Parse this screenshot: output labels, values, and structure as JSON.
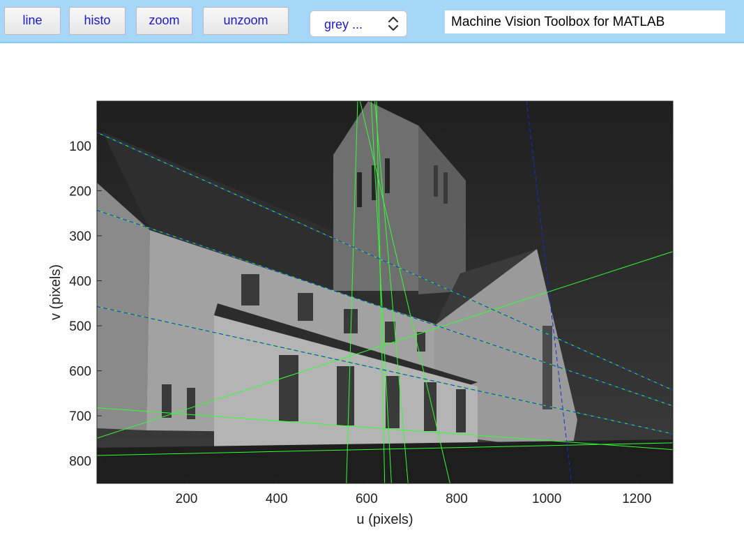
{
  "toolbar": {
    "line_label": "line",
    "histo_label": "histo",
    "zoom_label": "zoom",
    "unzoom_label": "unzoom",
    "colormap_value": "grey ...",
    "title": "Machine Vision Toolbox for MATLAB"
  },
  "axes": {
    "xlabel": "u (pixels)",
    "ylabel": "v (pixels)",
    "xlim": [
      1,
      1280
    ],
    "ylim": [
      1,
      850
    ],
    "y_reversed": true,
    "x_ticks": [
      200,
      400,
      600,
      800,
      1000,
      1200
    ],
    "y_ticks": [
      100,
      200,
      300,
      400,
      500,
      600,
      700,
      800
    ]
  },
  "overlay_lines": {
    "blue_dashed": [
      [
        [
          0,
          70
        ],
        [
          1280,
          643
        ]
      ],
      [
        [
          0,
          243
        ],
        [
          1280,
          678
        ]
      ],
      [
        [
          0,
          457
        ],
        [
          1280,
          740
        ]
      ],
      [
        [
          955,
          0
        ],
        [
          1055,
          850
        ]
      ]
    ],
    "green_solid": [
      [
        [
          0,
          70
        ],
        [
          1280,
          643
        ]
      ],
      [
        [
          0,
          243
        ],
        [
          1280,
          678
        ]
      ],
      [
        [
          0,
          457
        ],
        [
          1280,
          740
        ]
      ],
      [
        [
          580,
          0
        ],
        [
          555,
          850
        ]
      ],
      [
        [
          618,
          0
        ],
        [
          692,
          850
        ]
      ],
      [
        [
          610,
          0
        ],
        [
          655,
          850
        ]
      ],
      [
        [
          622,
          0
        ],
        [
          640,
          850
        ]
      ],
      [
        [
          585,
          0
        ],
        [
          785,
          850
        ]
      ],
      [
        [
          0,
          750
        ],
        [
          1280,
          335
        ]
      ],
      [
        [
          0,
          682
        ],
        [
          1280,
          775
        ]
      ],
      [
        [
          0,
          788
        ],
        [
          1280,
          760
        ]
      ]
    ]
  },
  "colors": {
    "toolbar_bg": "#a6d7f8",
    "button_text": "#1a1acc",
    "blue_line": "#1a2bd6",
    "green_line": "#33ff33"
  }
}
